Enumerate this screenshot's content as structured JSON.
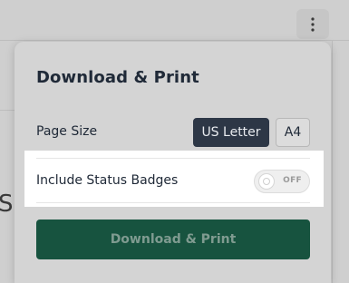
{
  "popover": {
    "title": "Download & Print",
    "page_size": {
      "label": "Page Size",
      "options": [
        "US Letter",
        "A4"
      ],
      "selected": "US Letter"
    },
    "status_badges": {
      "label": "Include Status Badges",
      "toggle_state": "OFF"
    },
    "download_button_label": "Download & Print"
  },
  "background": {
    "partial_text": "S"
  },
  "icons": {
    "menu": "kebab-menu-icon",
    "toggle_knob": "toggle-knob-icon"
  },
  "colors": {
    "primary_button": "#17533f",
    "segment_active": "#2d3746",
    "highlight": "#ffffff"
  }
}
